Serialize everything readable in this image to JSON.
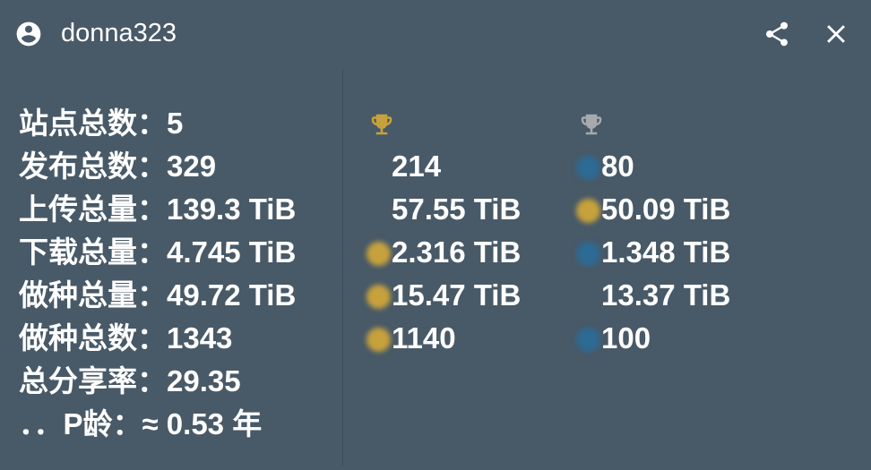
{
  "header": {
    "username": "donna323",
    "avatar_icon": "account-circle-icon",
    "share_icon": "share-icon",
    "close_icon": "close-icon"
  },
  "stats": [
    {
      "label": "站点总数：",
      "value": "5"
    },
    {
      "label": "发布总数：",
      "value": "329"
    },
    {
      "label": "上传总量：",
      "value": "139.3 TiB"
    },
    {
      "label": "下载总量：",
      "value": "4.745 TiB"
    },
    {
      "label": "做种总量：",
      "value": "49.72 TiB"
    },
    {
      "label": "做种总数：",
      "value": "1343"
    },
    {
      "label": "总分享率：",
      "value": "29.35"
    },
    {
      "label": "．．P龄：",
      "value": "≈ 0.53 年"
    }
  ],
  "rank_first": {
    "icon": "trophy-gold-icon",
    "color": "#c7a23c",
    "values": [
      "214",
      "57.55 TiB",
      "2.316 TiB",
      "15.47 TiB",
      "1140"
    ]
  },
  "rank_second": {
    "icon": "trophy-silver-icon",
    "color": "#a6aaad",
    "values": [
      "80",
      "50.09 TiB",
      "1.348 TiB",
      "13.37 TiB",
      "100"
    ]
  },
  "colors": {
    "background": "#485967",
    "gold_dot": "#c7a23c",
    "blue_dot": "#2d6a94"
  }
}
